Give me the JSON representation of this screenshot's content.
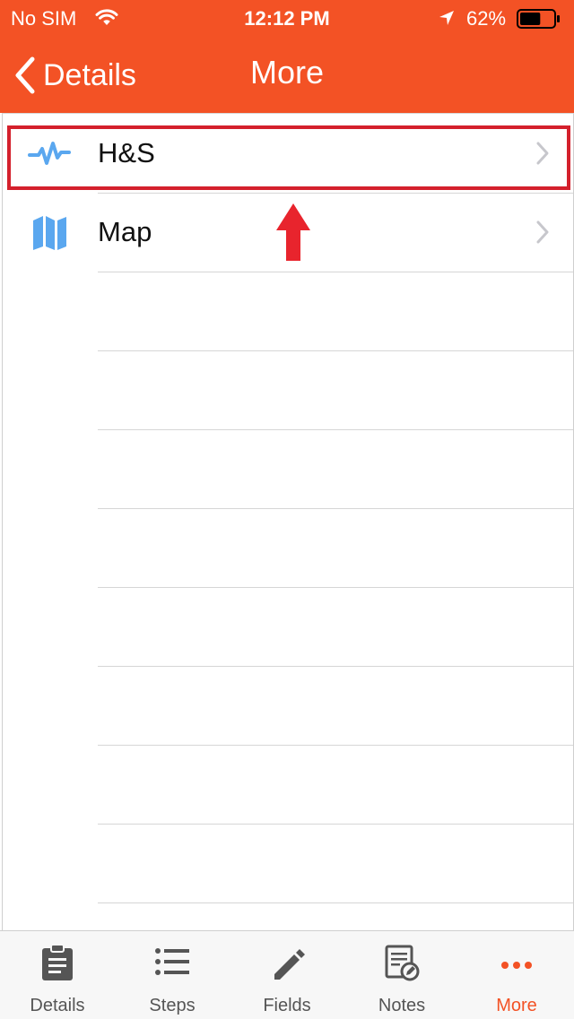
{
  "status_bar": {
    "carrier": "No SIM",
    "time": "12:12 PM",
    "battery_percent": "62%",
    "battery_level": 0.62,
    "icons": [
      "wifi-icon",
      "location-arrow-icon",
      "battery-icon"
    ]
  },
  "nav": {
    "back_label": "Details",
    "title": "More"
  },
  "list": {
    "items": [
      {
        "label": "H&S",
        "icon": "activity-icon"
      },
      {
        "label": "Map",
        "icon": "map-icon"
      }
    ]
  },
  "tabbar": {
    "tabs": [
      {
        "label": "Details",
        "icon": "clipboard-icon"
      },
      {
        "label": "Steps",
        "icon": "list-icon"
      },
      {
        "label": "Fields",
        "icon": "pencil-icon"
      },
      {
        "label": "Notes",
        "icon": "notes-icon"
      },
      {
        "label": "More",
        "icon": "more-dots-icon"
      }
    ],
    "active": "More"
  },
  "colors": {
    "brand": "#f35225",
    "highlight": "#d4202c",
    "icon_blue": "#5aa7ef",
    "tab_inactive": "#555555"
  }
}
